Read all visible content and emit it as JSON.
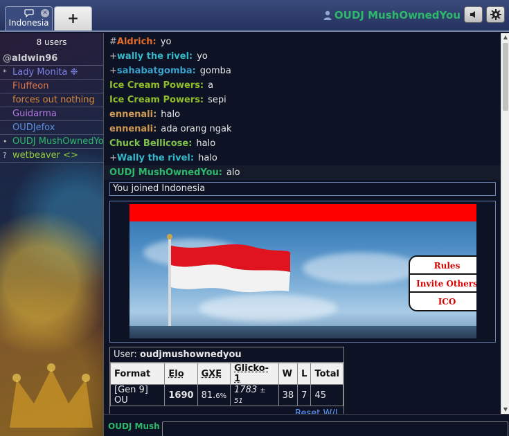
{
  "tabs": {
    "room": "Indonesia",
    "add": "+"
  },
  "header": {
    "username": "OUDJ MushOwnedYou"
  },
  "userlist": {
    "count": "8 users",
    "users": [
      {
        "sym": "@",
        "name": "aldwin96",
        "color": "#cfcfcf"
      },
      {
        "sym": "*",
        "name": "Lady Monita ❉",
        "color": "#7c84e8"
      },
      {
        "sym": "",
        "name": "Fluffeon",
        "color": "#e0794c"
      },
      {
        "sym": "",
        "name": "forces out nothing",
        "color": "#d88a3a"
      },
      {
        "sym": "",
        "name": "Guidarma",
        "color": "#b479e0"
      },
      {
        "sym": "",
        "name": "OUDJefox",
        "color": "#5a8fe0"
      },
      {
        "sym": "•",
        "name": "OUDJ MushOwnedYou",
        "color": "#2eb86a"
      },
      {
        "sym": "?",
        "name": "wetbeaver <>",
        "color": "#8fce3c"
      }
    ]
  },
  "messages": [
    {
      "sym": "#",
      "name": "Aldrich:",
      "text": "yo",
      "color": "#e06a2a"
    },
    {
      "sym": "+",
      "name": "wally the rivel:",
      "text": "yo",
      "color": "#36b9c9"
    },
    {
      "sym": "+",
      "name": "sahabatgomba:",
      "text": "gomba",
      "color": "#3aa0c9"
    },
    {
      "sym": "",
      "name": "Ice Cream Powers:",
      "text": "a",
      "color": "#8fbe2a"
    },
    {
      "sym": "",
      "name": "Ice Cream Powers:",
      "text": "sepi",
      "color": "#8fbe2a"
    },
    {
      "sym": "",
      "name": "ennenali:",
      "text": "halo",
      "color": "#d09a50"
    },
    {
      "sym": "",
      "name": "ennenali:",
      "text": "ada orang ngak",
      "color": "#d09a50"
    },
    {
      "sym": "",
      "name": "Chuck Bellicose:",
      "text": "halo",
      "color": "#7fc24a"
    },
    {
      "sym": "+",
      "name": "Wally the rivel:",
      "text": "halo",
      "color": "#36b9c9"
    },
    {
      "sym": "",
      "name": "OUDJ MushOwnedYou:",
      "text": "alo",
      "color": "#2eb86a"
    }
  ],
  "notice": "You joined Indonesia",
  "banner_buttons": [
    "Rules",
    "Invite Others",
    "ICO"
  ],
  "stats": {
    "user_label": "User:",
    "user": "oudjmushownedyou",
    "headers": [
      "Format",
      "Elo",
      "GXE",
      "Glicko-1",
      "W",
      "L",
      "Total"
    ],
    "row": {
      "format": "[Gen 9] OU",
      "elo": "1690",
      "gxe": "81.",
      "gxe_small": "6%",
      "glicko": "1783",
      "glicko_dev": "± 51",
      "w": "38",
      "l": "7",
      "total": "45"
    },
    "reset": "Reset W/L"
  },
  "compose": {
    "name": "OUDJ MushOwnedYou",
    "placeholder": ""
  },
  "colors": {
    "username": "#2eb86a",
    "accent": "#ff0000",
    "topbar": "#2e3d6c"
  }
}
